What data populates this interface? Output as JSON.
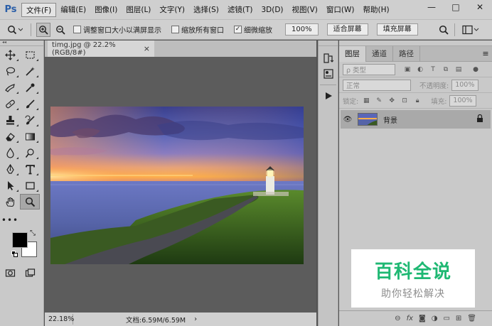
{
  "app": {
    "logo": "Ps"
  },
  "menu": {
    "items": [
      "文件(F)",
      "编辑(E)",
      "图像(I)",
      "图层(L)",
      "文字(Y)",
      "选择(S)",
      "滤镜(T)",
      "3D(D)",
      "视图(V)",
      "窗口(W)",
      "帮助(H)"
    ],
    "active_index": 0
  },
  "window_controls": {
    "minimize": "—",
    "maximize": "□",
    "close": "✕"
  },
  "options": {
    "resize_windows_label": "调整窗口大小以满屏显示",
    "resize_windows_checked": false,
    "zoom_all_label": "缩放所有窗口",
    "zoom_all_checked": false,
    "scrubby_zoom_label": "细微缩放",
    "scrubby_zoom_checked": true,
    "btn_100": "100%",
    "btn_fit": "适合屏幕",
    "btn_fill": "填充屏幕"
  },
  "document": {
    "tab_title": "timg.jpg @ 22.2%(RGB/8#)",
    "close_symbol": "×",
    "zoom": "22.18%",
    "info": "文档:6.59M/6.59M",
    "status_arrow": "›"
  },
  "layers_panel": {
    "tabs": [
      "图层",
      "通道",
      "路径"
    ],
    "active_tab": 0,
    "menu_symbol": "≡",
    "filter_kind": "ρ 类型",
    "blend_mode": "正常",
    "opacity_label": "不透明度:",
    "opacity_value": "100%",
    "lock_label": "锁定:",
    "fill_label": "填充:",
    "fill_value": "100%",
    "layers": [
      {
        "name": "背景",
        "visible": true,
        "locked": true
      }
    ],
    "footer_icons": [
      "link-icon",
      "fx-icon",
      "mask-icon",
      "adjustment-icon",
      "folder-icon",
      "new-layer-icon",
      "trash-icon"
    ],
    "footer_labels": [
      "⊖",
      "fx",
      "",
      "",
      "",
      "",
      ""
    ]
  },
  "watermark": {
    "title": "百科全说",
    "subtitle": "助你轻松解决"
  },
  "colors": {
    "foreground": "#000000",
    "background": "#ffffff",
    "accent": "#1fb873",
    "ps_blue": "#2a5ea8"
  }
}
